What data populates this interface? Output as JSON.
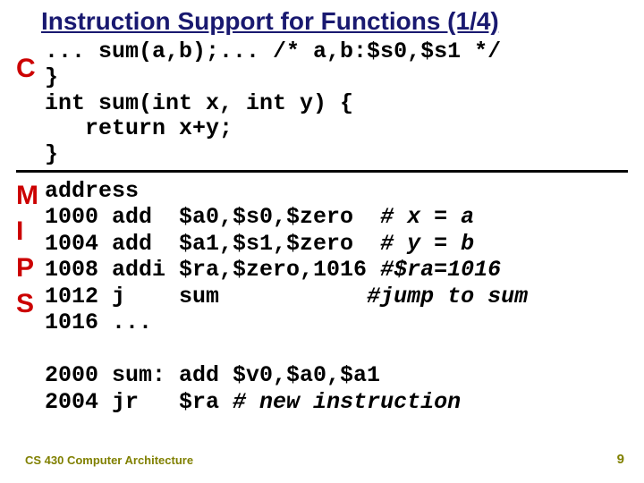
{
  "title": "Instruction Support for Functions (1/4)",
  "labels": {
    "c": "C",
    "mips": "M\nI\nP\nS"
  },
  "c_code": {
    "l1": "... sum(a,b);... /* a,b:$s0,$s1 */",
    "l2": "}",
    "l3": "int sum(int x, int y) {",
    "l4": "   return x+y;",
    "l5": "}"
  },
  "mips_code": {
    "head": "address",
    "l1a": "1000 add  $a0,$s0,$zero  ",
    "l1b": "# x = a",
    "l2a": "1004 add  $a1,$s1,$zero  ",
    "l2b": "# y = b",
    "l3a": "1008 addi $ra,$zero,1016 ",
    "l3b": "#$ra=1016",
    "l4a": "1012 j    sum           ",
    "l4b": "#jump to sum",
    "l5": "1016 ...",
    "blank": "",
    "l6": "2000 sum: add $v0,$a0,$a1",
    "l7a": "2004 jr   $ra ",
    "l7b": "# new instruction"
  },
  "footer": "CS 430 Computer Architecture",
  "page": "9"
}
